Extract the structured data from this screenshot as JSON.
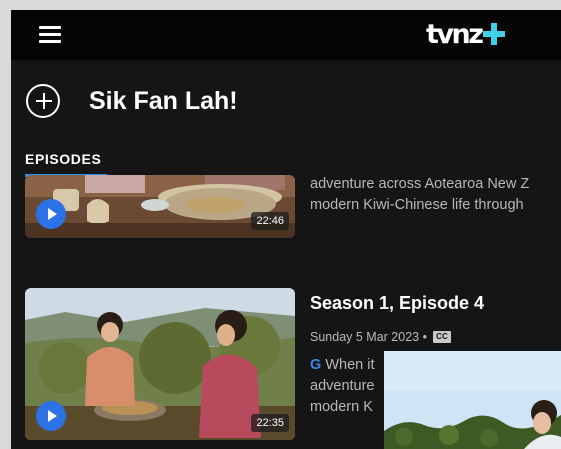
{
  "header": {
    "logo_text": "tvnz",
    "logo_plus_color": "#3fd0e8",
    "menu_icon": "hamburger-menu-icon"
  },
  "show": {
    "title": "Sik Fan Lah!",
    "add_icon": "plus-circle-icon"
  },
  "tabs": [
    {
      "label": "EPISODES",
      "active": true,
      "accent": "#2a8ff0"
    }
  ],
  "episodes": [
    {
      "duration": "22:46",
      "description_lines": [
        "adventure across Aotearoa New Z",
        "modern Kiwi-Chinese life through"
      ]
    },
    {
      "title": "Season 1, Episode 4",
      "date": "Sunday 5 Mar 2023 •",
      "cc_label": "CC",
      "rating": "G",
      "description_lines": [
        "When it",
        "adventure",
        "modern K"
      ],
      "duration": "22:35"
    }
  ],
  "colors": {
    "play_button": "#2c72e6",
    "background": "#151515"
  }
}
